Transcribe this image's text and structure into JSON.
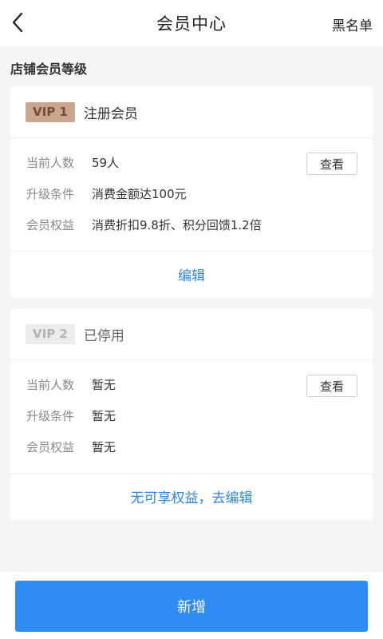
{
  "header": {
    "title": "会员中心",
    "right_action": "黑名单",
    "back_icon": "chevron-left-icon"
  },
  "section": {
    "title": "店铺会员等级"
  },
  "levels": [
    {
      "badge": "VIP 1",
      "name": "注册会员",
      "status": "active",
      "badge_bg": "#c9a690",
      "badge_color": "#7a4b34",
      "rows": [
        {
          "label": "当前人数",
          "value": "59人"
        },
        {
          "label": "升级条件",
          "value": "消费金额达100元"
        },
        {
          "label": "会员权益",
          "value": "消费折扣9.8折、积分回馈1.2倍"
        }
      ],
      "view_label": "查看",
      "footer_action": "编辑"
    },
    {
      "badge": "VIP 2",
      "name": "已停用",
      "status": "disabled",
      "badge_bg": "#ececec",
      "badge_color": "#b3b3b3",
      "rows": [
        {
          "label": "当前人数",
          "value": "暂无"
        },
        {
          "label": "升级条件",
          "value": "暂无"
        },
        {
          "label": "会员权益",
          "value": "暂无"
        }
      ],
      "view_label": "查看",
      "footer_action": "无可享权益，去编辑"
    }
  ],
  "footer": {
    "add_label": "新增"
  },
  "colors": {
    "accent": "#2f8cf5",
    "link": "#2f86e0",
    "background": "#f5f5f7"
  }
}
